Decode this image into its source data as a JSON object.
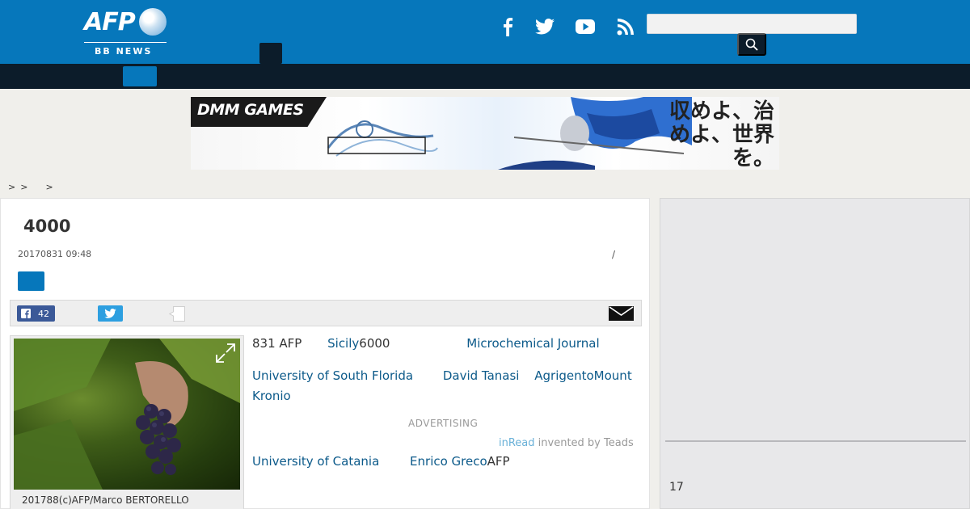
{
  "header": {
    "logo_text": "AFP",
    "logo_sub": "BB NEWS",
    "search_placeholder": "",
    "colors": {
      "brand_blue": "#0677bb",
      "nav_dark": "#0c1c2a"
    }
  },
  "social_icons": [
    "facebook-icon",
    "twitter-icon",
    "youtube-icon",
    "rss-icon"
  ],
  "banner": {
    "brand": "DMM GAMES",
    "kanji": "収めよ、治めよ、世界を。"
  },
  "breadcrumb": [
    ">",
    ">",
    ">"
  ],
  "article": {
    "title": "4000",
    "date": "20170831 09:48",
    "slash": "/",
    "share": {
      "facebook_count": "42"
    },
    "photo_caption": "201788(c)AFP/Marco BERTORELLO",
    "paragraphs": [
      {
        "parts": [
          {
            "t": "831 AFP",
            "link": false
          },
          {
            "t": "Sicily",
            "link": true
          },
          {
            "t": "6000",
            "link": false
          },
          {
            "t": "Microchemical Journal",
            "link": true
          }
        ]
      },
      {
        "parts": [
          {
            "t": "University of South Florida",
            "link": true
          },
          {
            "t": "David Tanasi",
            "link": true
          },
          {
            "t": "AgrigentoMount Kronio",
            "link": true
          }
        ]
      },
      {
        "parts": [
          {
            "t": "University of Catania",
            "link": true
          },
          {
            "t": "Enrico Greco",
            "link": true
          },
          {
            "t": "AFP",
            "link": false
          }
        ]
      }
    ],
    "advertising_label": "ADVERTISING",
    "inread_brand": "inRead",
    "inread_suffix": " invented by Teads"
  },
  "sidebar": {
    "count": "17"
  }
}
